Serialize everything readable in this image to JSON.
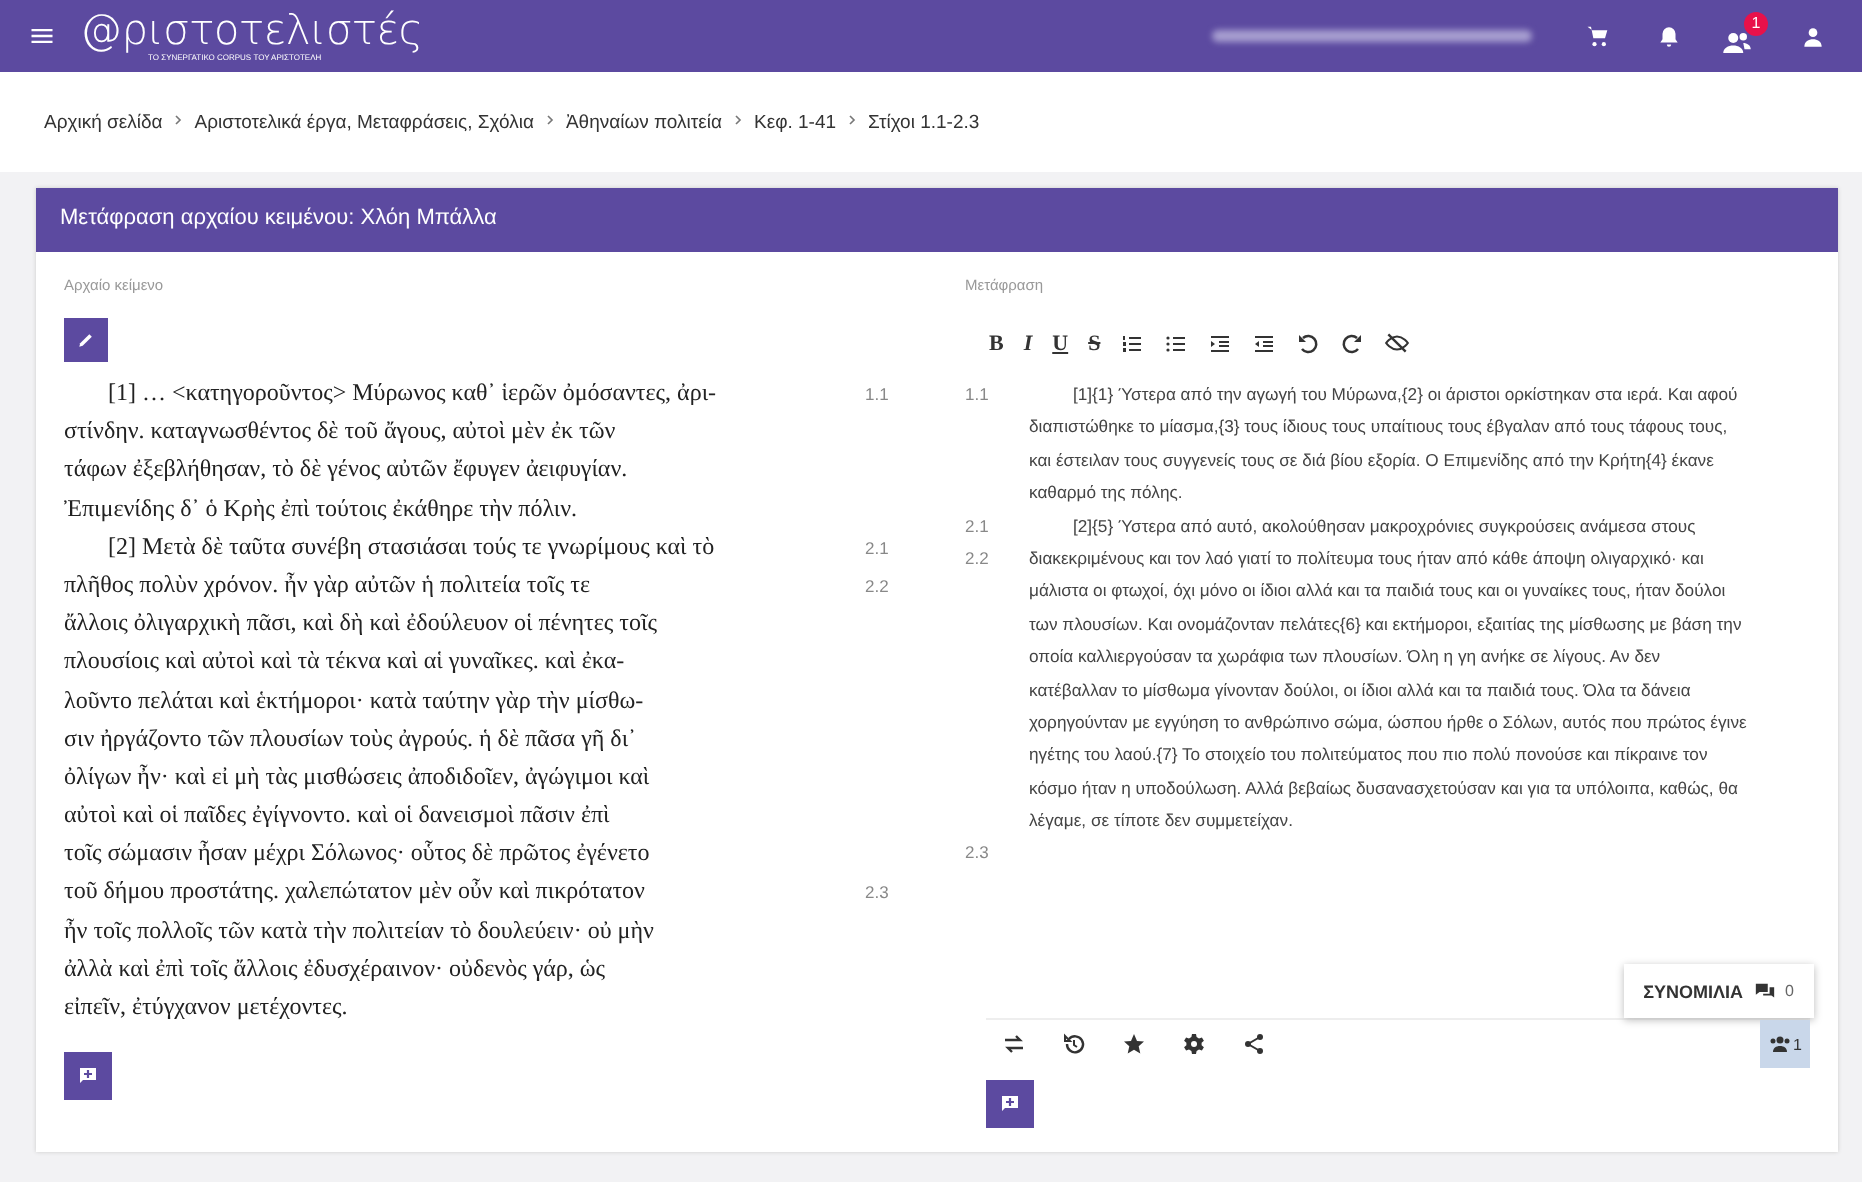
{
  "header": {
    "logo": "@ριστοτελιστές",
    "tagline": "ΤΟ ΣΥΝΕΡΓΑΤΙΚΟ CORPUS ΤΟΥ ΑΡΙΣΤΟΤΕΛΗ",
    "notification_count": "1"
  },
  "breadcrumb": [
    "Αρχική σελίδα",
    "Αριστοτελικά έργα, Μεταφράσεις, Σχόλια",
    "Ἀθηναίων πολιτεία",
    "Κεφ. 1-41",
    "Στίχοι 1.1-2.3"
  ],
  "card": {
    "title": "Μετάφραση αρχαίου κειμένου: Χλόη Μπάλλα"
  },
  "original": {
    "label": "Αρχαίο κείμενο",
    "lines": [
      {
        "text": "[1] … <κατηγοροῦντος> Μύρωνος καθ᾽ ἱερῶν ὀμόσαντες, ἀρι-",
        "ref": "1.1",
        "indent": true
      },
      {
        "text": "στίνδην. καταγνωσθέντος δὲ τοῦ ἄγους, αὐτοὶ μὲν ἐκ τῶν"
      },
      {
        "text": "τάφων ἐξεβλήθησαν, τὸ δὲ γένος αὐτῶν ἔφυγεν ἀειφυγίαν."
      },
      {
        "text": "Ἐπιμενίδης δ᾽ ὁ Κρὴς ἐπὶ τούτοις ἐκάθηρε τὴν πόλιν."
      },
      {
        "text": "[2] Μετὰ δὲ ταῦτα συνέβη στασιάσαι τούς τε γνωρίμους καὶ τὸ",
        "ref": "2.1",
        "indent": true
      },
      {
        "text": "πλῆθος πολὺν χρόνον. ἦν γὰρ αὐτῶν ἡ πολιτεία τοῖς τε",
        "ref": "2.2"
      },
      {
        "text": "ἄλλοις ὀλιγαρχικὴ πᾶσι, καὶ δὴ καὶ ἐδούλευον οἱ πένητες τοῖς"
      },
      {
        "text": "πλουσίοις καὶ αὐτοὶ καὶ τὰ τέκνα καὶ αἱ γυναῖκες. καὶ ἐκα-"
      },
      {
        "text": "λοῦντο πελάται καὶ ἑκτήμοροι· κατὰ ταύτην γὰρ τὴν μίσθω-"
      },
      {
        "text": "σιν ἠργάζοντο τῶν πλουσίων τοὺς ἀγρούς. ἡ δὲ πᾶσα γῆ δι᾽"
      },
      {
        "text": "ὀλίγων ἦν· καὶ εἰ μὴ τὰς μισθώσεις ἀποδιδοῖεν, ἀγώγιμοι καὶ"
      },
      {
        "text": "αὐτοὶ καὶ οἱ παῖδες ἐγίγνοντο. καὶ οἱ δανεισμοὶ πᾶσιν ἐπὶ"
      },
      {
        "text": "τοῖς σώμασιν ἦσαν μέχρι Σόλωνος· οὗτος δὲ πρῶτος ἐγένετο"
      },
      {
        "text": "τοῦ δήμου προστάτης. χαλεπώτατον μὲν οὖν καὶ πικρότατον",
        "ref": "2.3"
      },
      {
        "text": "ἦν τοῖς πολλοῖς τῶν κατὰ τὴν πολιτείαν τὸ δουλεύειν· οὐ μὴν"
      },
      {
        "text": "ἀλλὰ καὶ ἐπὶ τοῖς ἄλλοις ἐδυσχέραινον· οὐδενὸς γάρ, ὡς"
      },
      {
        "text": "εἰπεῖν, ἐτύγχανον μετέχοντες."
      }
    ]
  },
  "translation": {
    "label": "Μετάφραση",
    "toolbar": [
      "B",
      "I",
      "U",
      "S"
    ],
    "lines": [
      {
        "text": "[1]{1} Ύστερα από την αγωγή του Μύρωνα,{2} οι άριστοι ορκίστηκαν στα ιερά. Και αφού",
        "ref": "1.1",
        "indent": true
      },
      {
        "text": "διαπιστώθηκε το μίασμα,{3} τους ίδιους τους υπαίτιους τους έβγαλαν από τους τάφους τους,"
      },
      {
        "text": "και έστειλαν τους συγγενείς τους σε διά βίου εξορία. Ο Επιμενίδης από την Κρήτη{4} έκανε"
      },
      {
        "text": "καθαρμό της πόλης."
      },
      {
        "text": "[2]{5} Ύστερα από αυτό, ακολούθησαν μακροχρόνιες συγκρούσεις ανάμεσα στους",
        "ref": "2.1",
        "indent": true
      },
      {
        "text": "διακεκριμένους και τον λαό γιατί το πολίτευμα τους ήταν από κάθε άποψη ολιγαρχικό· και",
        "ref": "2.2"
      },
      {
        "text": "μάλιστα οι φτωχοί, όχι μόνο οι ίδιοι αλλά και τα παιδιά τους και οι γυναίκες τους, ήταν δούλοι"
      },
      {
        "text": "των πλουσίων. Και ονομάζονταν πελάτες{6} και εκτήμοροι, εξαιτίας της μίσθωσης με βάση την"
      },
      {
        "text": "οποία καλλιεργούσαν τα χωράφια των πλουσίων. Όλη η γη ανήκε σε λίγους. Αν δεν"
      },
      {
        "text": "κατέβαλλαν το μίσθωμα γίνονταν δούλοι, οι ίδιοι αλλά και τα παιδιά τους. Όλα τα δάνεια"
      },
      {
        "text": "χορηγούνταν με εγγύηση το ανθρώπινο σώμα, ώσπου ήρθε ο Σόλων, αυτός που πρώτος έγινε"
      },
      {
        "text": "ηγέτης του λαού.{7} Το στοιχείο του πολιτεύματος που πιο πολύ πονούσε και πίκραινε τον"
      },
      {
        "text": "κόσμο ήταν η υποδούλωση. Αλλά βεβαίως δυσανασχετούσαν και για τα υπόλοιπα, καθώς, θα"
      },
      {
        "text": "λέγαμε, σε τίποτε δεν συμμετείχαν."
      },
      {
        "ref": "2.3"
      }
    ],
    "chat": {
      "label": "ΣΥΝΟΜΙΛΙΑ",
      "count": "0"
    },
    "users_count": "1"
  }
}
